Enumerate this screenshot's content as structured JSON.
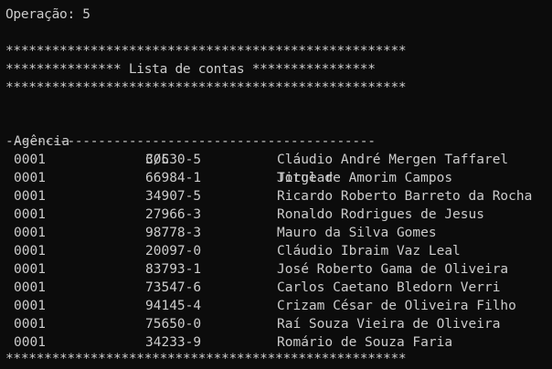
{
  "console": {
    "operation_line": "Operação: 5",
    "stars_line": "****************************************************",
    "title_line": "*************** Lista de contas ****************",
    "dash_line": "------------------------------------------------",
    "bottom_stars_line": "****************************************************"
  },
  "table": {
    "columns": [
      "Agência",
      "C/C",
      "Titular"
    ],
    "rows": [
      [
        "0001",
        "30530-5",
        "Cláudio André Mergen Taffarel"
      ],
      [
        "0001",
        "66984-1",
        "Jorge de Amorim Campos"
      ],
      [
        "0001",
        "34907-5",
        "Ricardo Roberto Barreto da Rocha"
      ],
      [
        "0001",
        "27966-3",
        "Ronaldo Rodrigues de Jesus"
      ],
      [
        "0001",
        "98778-3",
        "Mauro da Silva Gomes"
      ],
      [
        "0001",
        "20097-0",
        "Cláudio Ibraim Vaz Leal"
      ],
      [
        "0001",
        "83793-1",
        "José Roberto Gama de Oliveira"
      ],
      [
        "0001",
        "73547-6",
        "Carlos Caetano Bledorn Verri"
      ],
      [
        "0001",
        "94145-4",
        "Crizam César de Oliveira Filho"
      ],
      [
        "0001",
        "75650-0",
        "Raí Souza Vieira de Oliveira"
      ],
      [
        "0001",
        "34233-9",
        "Romário de Souza Faria"
      ]
    ]
  },
  "colors": {
    "background": "#0c0c0c",
    "text": "#cccccc"
  }
}
